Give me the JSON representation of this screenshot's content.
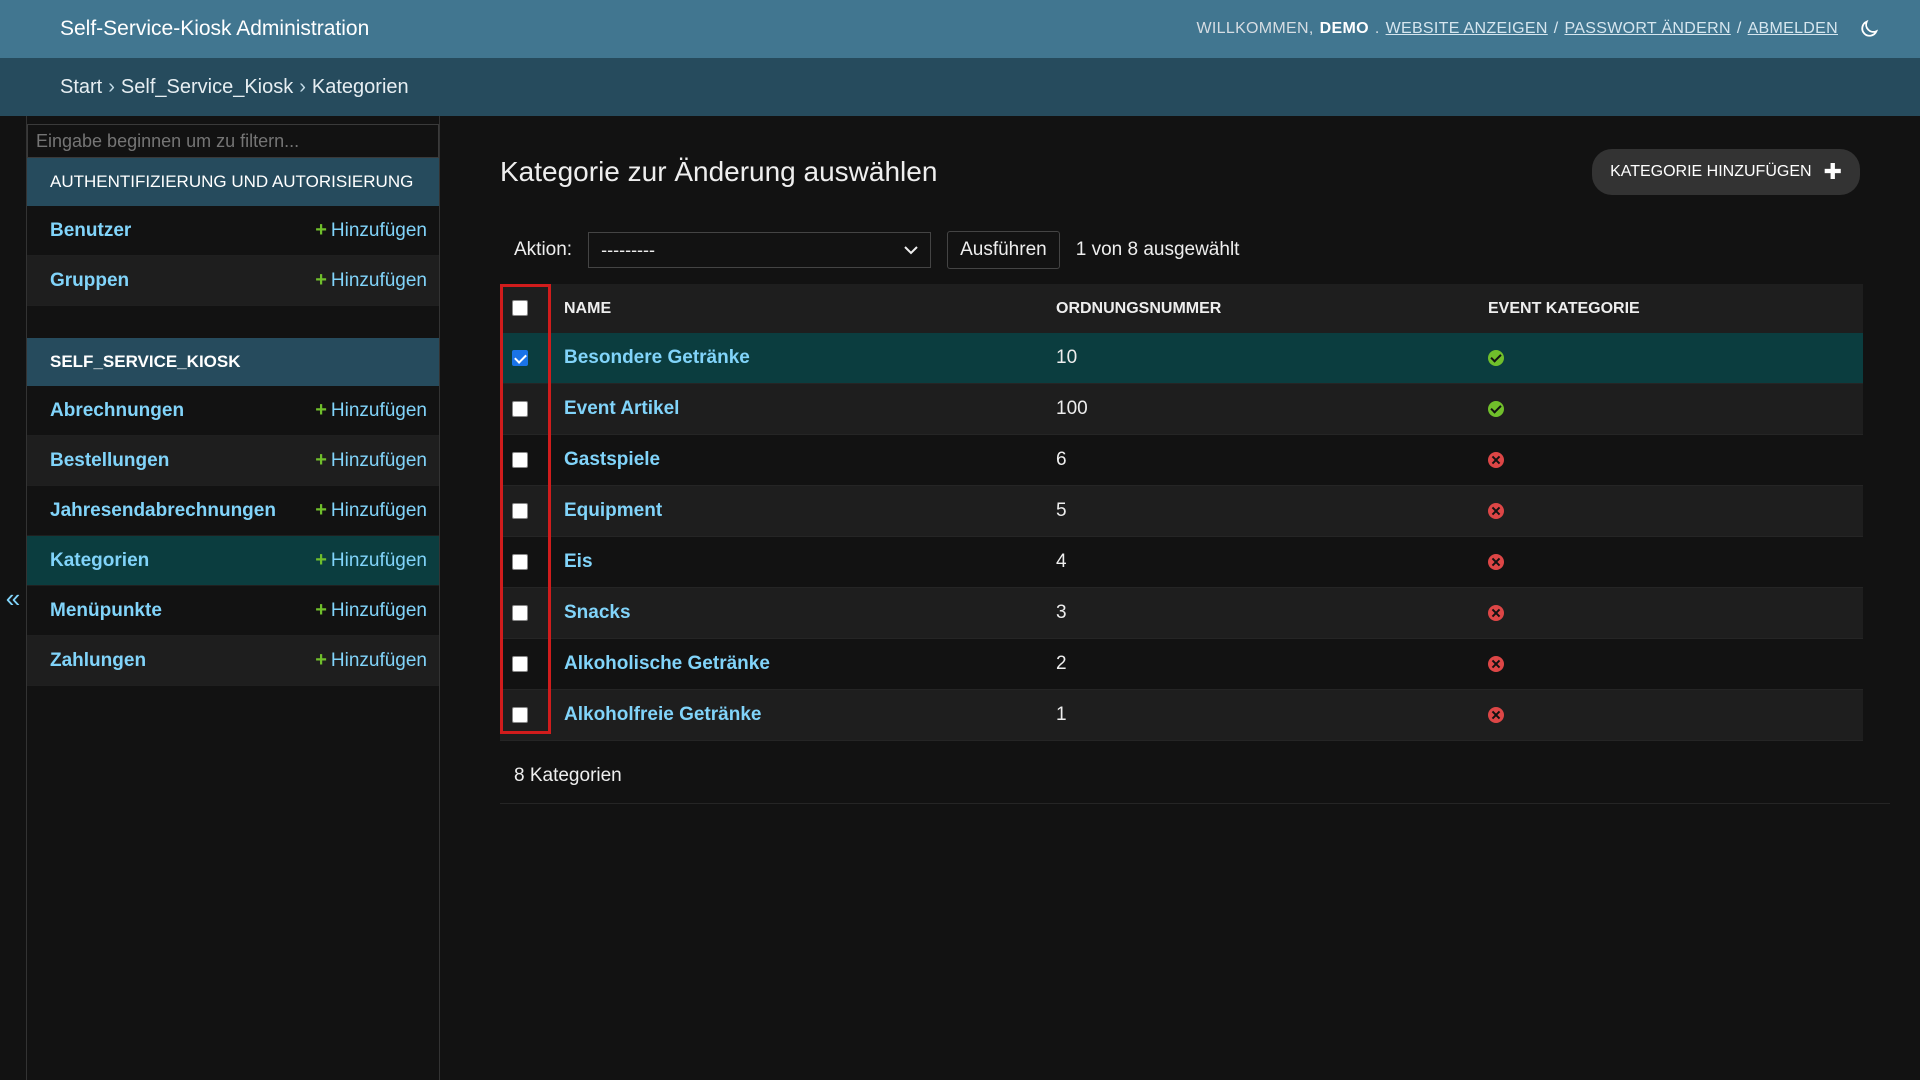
{
  "header": {
    "title": "Self-Service-Kiosk Administration",
    "welcome": "Willkommen,",
    "username": "Demo",
    "view_site": "Website anzeigen",
    "change_password": "Passwort ändern",
    "logout": "Abmelden",
    "separator": "/"
  },
  "breadcrumbs": {
    "home": "Start",
    "app": "Self_Service_Kiosk",
    "current": "Kategorien",
    "separator": "›"
  },
  "sidebar": {
    "toggle": "«",
    "filter_placeholder": "Eingabe beginnen um zu filtern...",
    "add_label": "Hinzufügen",
    "modules": [
      {
        "caption": "Authentifizierung und Autorisierung",
        "items": [
          {
            "label": "Benutzer"
          },
          {
            "label": "Gruppen"
          }
        ]
      },
      {
        "caption": "Self_Service_Kiosk",
        "items": [
          {
            "label": "Abrechnungen"
          },
          {
            "label": "Bestellungen"
          },
          {
            "label": "Jahresendabrechnungen"
          },
          {
            "label": "Kategorien",
            "active": true
          },
          {
            "label": "Menüpunkte"
          },
          {
            "label": "Zahlungen"
          }
        ]
      }
    ]
  },
  "content": {
    "title": "Kategorie zur Änderung auswählen",
    "add_button": "Kategorie hinzufügen",
    "actions": {
      "label": "Aktion:",
      "selected_value": "---------",
      "go_button": "Ausführen",
      "selection_count": "1 von 8 ausgewählt"
    },
    "columns": [
      "Name",
      "Ordnungsnummer",
      "Event Kategorie"
    ],
    "rows": [
      {
        "name": "Besondere Getränke",
        "order": "10",
        "event": true,
        "checked": true
      },
      {
        "name": "Event Artikel",
        "order": "100",
        "event": true,
        "checked": false
      },
      {
        "name": "Gastspiele",
        "order": "6",
        "event": false,
        "checked": false
      },
      {
        "name": "Equipment",
        "order": "5",
        "event": false,
        "checked": false
      },
      {
        "name": "Eis",
        "order": "4",
        "event": false,
        "checked": false
      },
      {
        "name": "Snacks",
        "order": "3",
        "event": false,
        "checked": false
      },
      {
        "name": "Alkoholische Getränke",
        "order": "2",
        "event": false,
        "checked": false
      },
      {
        "name": "Alkoholfreie Getränke",
        "order": "1",
        "event": false,
        "checked": false
      }
    ],
    "paginator": "8 Kategorien"
  },
  "colors": {
    "header_bg": "#417690",
    "breadcrumb_bg": "#264b5d",
    "link": "#81d4fa",
    "selected_row": "#0b3d3f",
    "highlight": "#d01c1c"
  }
}
